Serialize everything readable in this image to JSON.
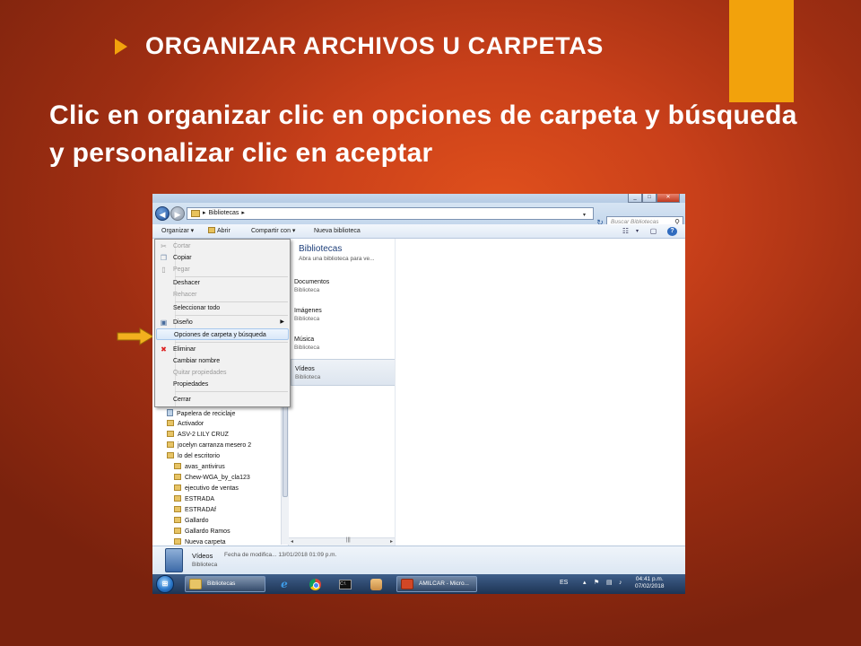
{
  "slide": {
    "heading": "ORGANIZAR ARCHIVOS U CARPETAS",
    "subtitle": "Clic en organizar clic en opciones de carpeta y búsqueda y personalizar clic en aceptar",
    "colors": {
      "accent": "#f2a20c",
      "background": "#c9401a",
      "text": "#ffffff"
    }
  },
  "explorer": {
    "address": {
      "path": "Bibliotecas",
      "search_placeholder": "Buscar Bibliotecas"
    },
    "toolbar": {
      "organize": "Organizar",
      "open": "Abrir",
      "share": "Compartir con",
      "new_library": "Nueva biblioteca"
    },
    "organize_menu": {
      "items": [
        {
          "label": "Cortar",
          "icon": "scissors-icon",
          "disabled": true
        },
        {
          "label": "Copiar",
          "icon": "copy-icon",
          "disabled": false
        },
        {
          "label": "Pegar",
          "icon": "paste-icon",
          "disabled": true
        },
        {
          "label": "Deshacer",
          "icon": "",
          "disabled": false
        },
        {
          "label": "Rehacer",
          "icon": "",
          "disabled": true
        },
        {
          "label": "Seleccionar todo",
          "icon": "",
          "disabled": false
        },
        {
          "label": "Diseño",
          "icon": "layout-icon",
          "disabled": false,
          "submenu": true
        },
        {
          "label": "Opciones de carpeta y búsqueda",
          "icon": "",
          "disabled": false,
          "highlighted": true
        },
        {
          "label": "Eliminar",
          "icon": "delete-icon",
          "disabled": false
        },
        {
          "label": "Cambiar nombre",
          "icon": "",
          "disabled": false
        },
        {
          "label": "Quitar propiedades",
          "icon": "",
          "disabled": true
        },
        {
          "label": "Propiedades",
          "icon": "",
          "disabled": false
        },
        {
          "label": "Cerrar",
          "icon": "",
          "disabled": false
        }
      ]
    },
    "nav_tree": [
      "Papelera de reciclaje",
      "Activador",
      "ASV-2 LILY CRUZ",
      "jocelyn carranza mesero 2",
      "lo del escritorio",
      "avas_antivirus",
      "Chew-WGA_by_cla123",
      "ejecutivo de ventas",
      "ESTRADA",
      "ESTRADAf",
      "Gallardo",
      "Gallardo Ramos",
      "Nueva carpeta"
    ],
    "content": {
      "title": "Bibliotecas",
      "subtitle": "Abra una biblioteca para ve...",
      "libraries": [
        {
          "name": "Documentos",
          "type": "Biblioteca"
        },
        {
          "name": "Imágenes",
          "type": "Biblioteca"
        },
        {
          "name": "Música",
          "type": "Biblioteca"
        },
        {
          "name": "Vídeos",
          "type": "Biblioteca",
          "selected": true
        }
      ]
    },
    "details": {
      "name": "Vídeos",
      "type": "Biblioteca",
      "modified": "Fecha de modifica... 13/01/2018 01:09 p.m."
    }
  },
  "taskbar": {
    "tasks": [
      "Bibliotecas",
      "AMILCAR - Micro..."
    ],
    "language": "ES",
    "time": "04:41 p.m.",
    "date": "07/02/2018"
  }
}
